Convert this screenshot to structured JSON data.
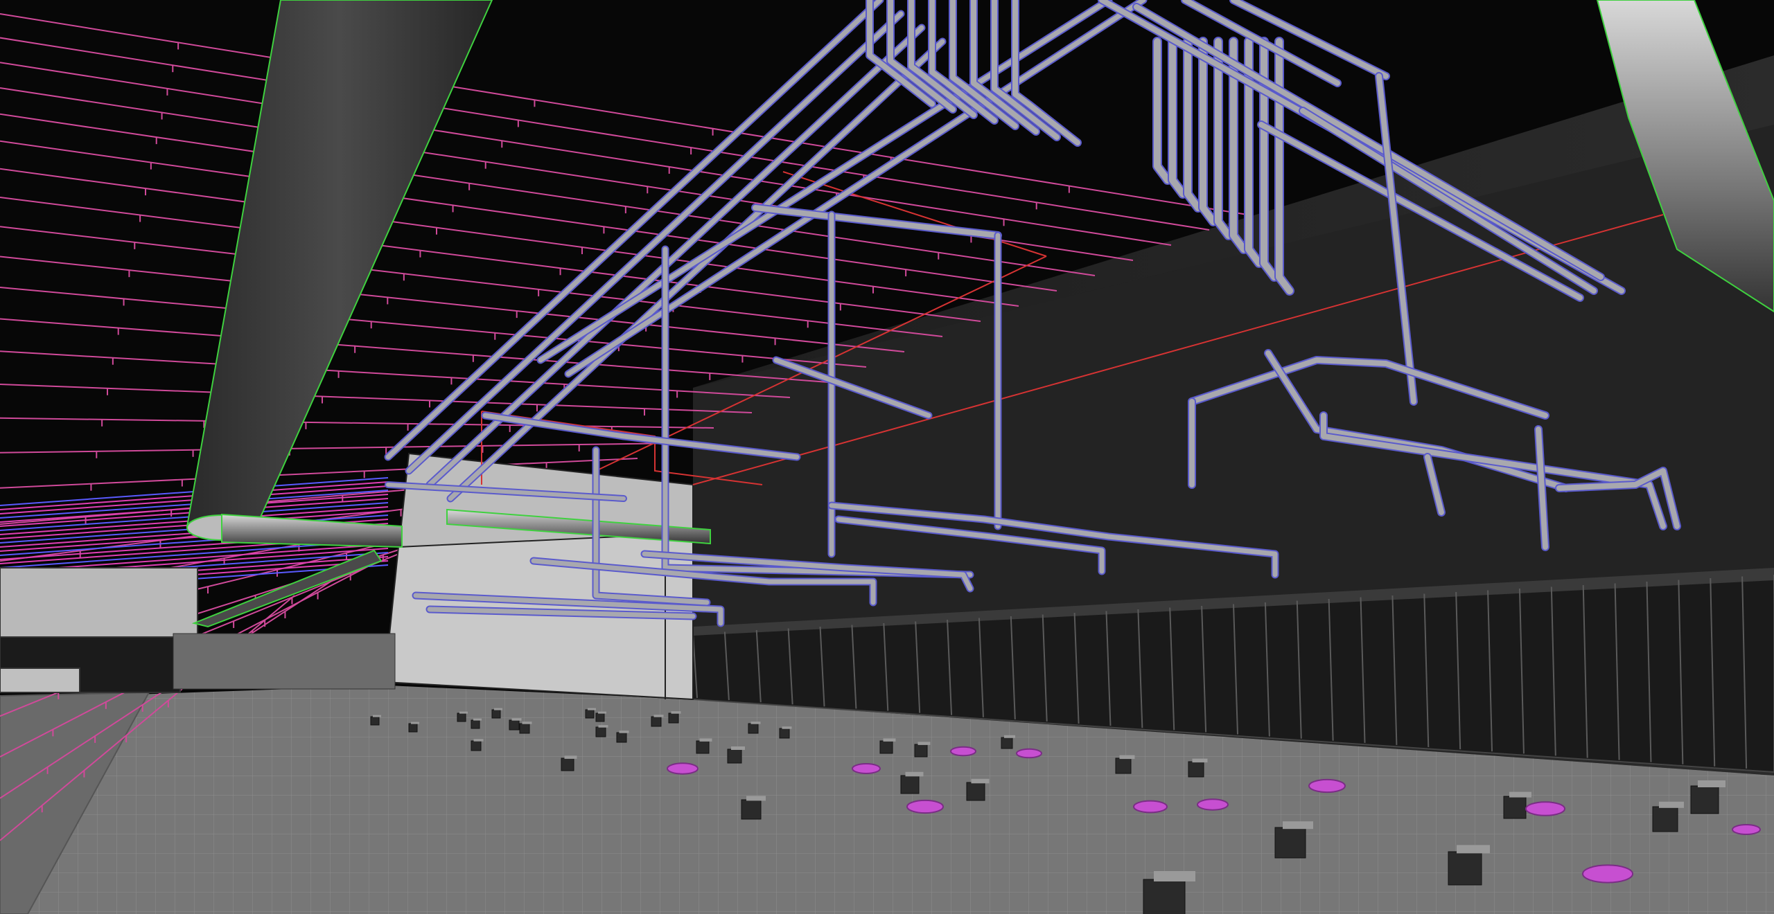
{
  "viewport": {
    "label": "",
    "background": "#050505"
  },
  "colors": {
    "ceiling": "#0a0a0a",
    "wall": "#262626",
    "floor": "#7a7a7a",
    "floor_grid": "#8c8c8c",
    "pipe_fill": "#9a9a9f",
    "pipe_outline": "#5a5acc",
    "duct_fill": "#3a3a3a",
    "duct_outline": "#3fd13f",
    "sprinkler_line": "#d04a9a",
    "red_line": "#d62b2b",
    "block_fill": "#9f9f9f",
    "magenta_marker": "#c74fd1",
    "building_fill": "#c6c6c6"
  },
  "layers": {
    "ceiling_grid": "ceiling-grid",
    "sprinkler_lines": "sprinkler-lines",
    "main_ducts": "main-ducts",
    "pipe_racks": "pipe-racks",
    "wall_panels": "wall-panels",
    "floor_grid": "floor-grid",
    "floor_blocks": "floor-blocks"
  }
}
